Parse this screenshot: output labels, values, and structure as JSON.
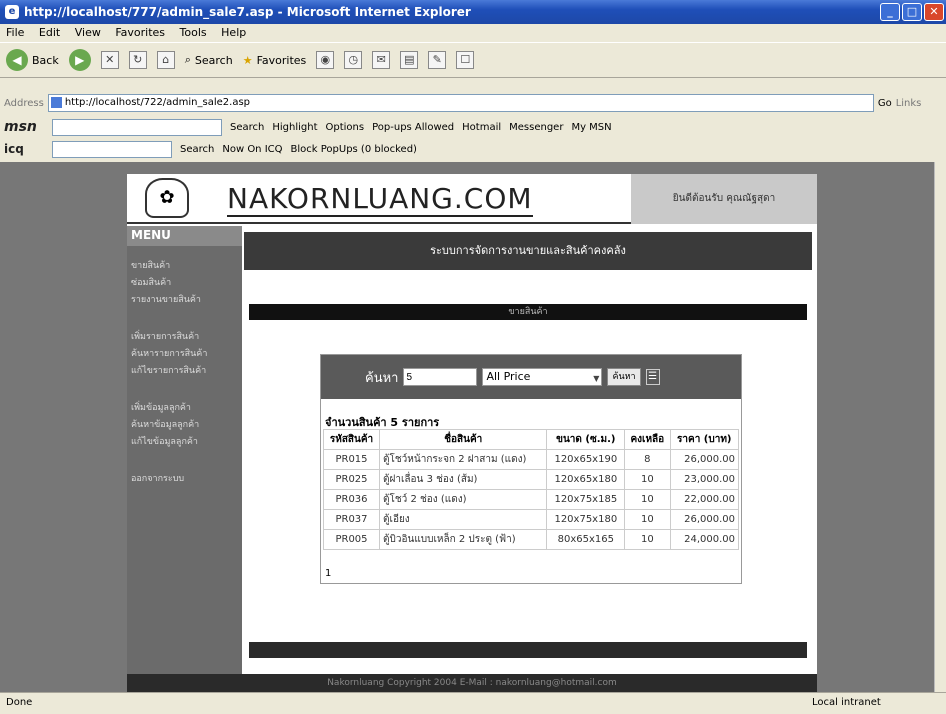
{
  "window": {
    "title": "http://localhost/777/admin_sale7.asp - Microsoft Internet Explorer",
    "minimize": "_",
    "maximize": "□",
    "close": "✕"
  },
  "menubar": [
    "File",
    "Edit",
    "View",
    "Favorites",
    "Tools",
    "Help"
  ],
  "toolbar": {
    "back": "Back",
    "search": "Search",
    "favorites": "Favorites"
  },
  "address": {
    "label": "Address",
    "url": "http://localhost/722/admin_sale2.asp",
    "go": "Go",
    "links": "Links"
  },
  "msn": {
    "logo": "msn",
    "search": "Search",
    "highlight": "Highlight",
    "options": "Options",
    "popups": "Pop-ups Allowed",
    "hotmail": "Hotmail",
    "messenger": "Messenger",
    "mymsn": "My MSN"
  },
  "icq": {
    "logo": "icq",
    "search": "Search",
    "now": "Now On ICQ",
    "block": "Block PopUps (0 blocked)"
  },
  "header": {
    "site": "NAKORNLUANG.COM",
    "welcome": "ยินดีต้อนรับ คุณณัฐสุดา"
  },
  "side": {
    "menu": "MENU",
    "items": [
      "ขายสินค้า",
      "ซ่อมสินค้า",
      "รายงานขายสินค้า",
      "เพิ่มรายการสินค้า",
      "ค้นหารายการสินค้า",
      "แก้ไขรายการสินค้า",
      "เพิ่มข้อมูลลูกค้า",
      "ค้นหาข้อมูลลูกค้า",
      "แก้ไขข้อมูลลูกค้า",
      "ออกจากระบบ"
    ]
  },
  "main": {
    "title": "ระบบการจัดการงานขายและสินค้าคงคลัง",
    "subtitle": "ขายสินค้า"
  },
  "search": {
    "label": "ค้นหา",
    "value": "5",
    "price": "All Price",
    "button": "ค้นหา"
  },
  "table": {
    "count": "จำนวนสินค้า 5 รายการ",
    "headers": [
      "รหัสสินค้า",
      "ชื่อสินค้า",
      "ขนาด (ซ.ม.)",
      "คงเหลือ",
      "ราคา (บาท)"
    ],
    "rows": [
      [
        "PR015",
        "ตู้โชว์หน้ากระจก 2 ฝาสาม (แดง)",
        "120x65x190",
        "8",
        "26,000.00"
      ],
      [
        "PR025",
        "ตู้ฝาเลื่อน 3 ช่อง (ส้ม)",
        "120x65x180",
        "10",
        "23,000.00"
      ],
      [
        "PR036",
        "ตู้โชว์ 2 ช่อง (แดง)",
        "120x75x185",
        "10",
        "22,000.00"
      ],
      [
        "PR037",
        "ตู้เอียง",
        "120x75x180",
        "10",
        "26,000.00"
      ],
      [
        "PR005",
        "ตู้บิวอินแบบเหล็ก 2 ประตู (ฟ้า)",
        "80x65x165",
        "10",
        "24,000.00"
      ]
    ],
    "page": "1"
  },
  "footer": "Nakornluang Copyright 2004 E-Mail : nakornluang@hotmail.com",
  "status": {
    "done": "Done",
    "zone": "Local intranet"
  }
}
